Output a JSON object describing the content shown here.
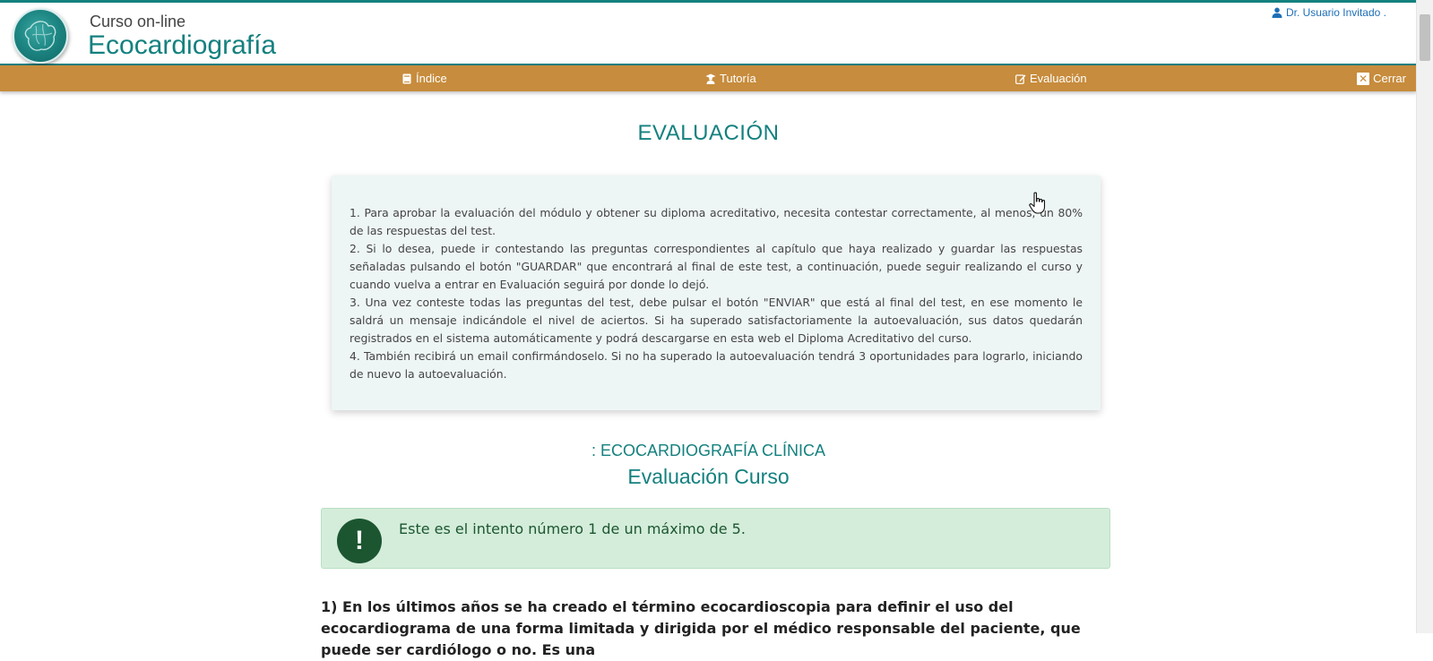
{
  "header": {
    "brand_small": "Curso  on-line",
    "brand_big": "Ecocardiografía",
    "user": "Dr. Usuario Invitado ."
  },
  "nav": {
    "indice": "Índice",
    "tutoria": "Tutoría",
    "evaluacion": "Evaluación",
    "cerrar": "Cerrar"
  },
  "main": {
    "title": "EVALUACIÓN",
    "instructions": [
      "1. Para aprobar la evaluación del módulo y obtener su diploma acreditativo, necesita contestar correctamente, al menos, un 80% de las respuestas del test.",
      "2. Si lo desea, puede ir contestando las preguntas correspondientes al capítulo que haya realizado y guardar las respuestas señaladas pulsando el botón \"GUARDAR\" que encontrará al final de este test, a continuación, puede seguir realizando el curso y cuando vuelva a entrar en Evaluación seguirá por donde lo dejó.",
      "3. Una vez conteste todas las preguntas del test, debe pulsar el botón \"ENVIAR\" que está al final del test, en ese momento le saldrá un mensaje indicándole el nivel de aciertos. Si ha superado satisfactoriamente la autoevaluación, sus datos quedarán registrados en el sistema automáticamente y podrá descargarse en esta web el Diploma Acreditativo del curso.",
      "4. También recibirá un email confirmándoselo. Si no ha superado la autoevaluación tendrá 3 oportunidades para lograrlo, iniciando de nuevo la autoevaluación."
    ],
    "module_title": ": ECOCARDIOGRAFÍA CLÍNICA",
    "eval_title": "Evaluación Curso",
    "alert_icon": "!",
    "alert_text": "Este es el intento número 1 de un máximo de 5.",
    "question_text": "1) En los últimos años se ha creado el término ecocardioscopia para definir el uso del ecocardiograma de una forma limitada y dirigida por el médico responsable del paciente, que puede ser cardiólogo o no. Es una"
  },
  "colors": {
    "teal": "#14817f",
    "nav_bg": "#c78c3d",
    "alert_bg": "#d4edda",
    "alert_dark": "#1c5631",
    "instructions_bg": "#eef5f5"
  },
  "icons": {
    "logo": "heart-logo",
    "user": "user-icon",
    "indice": "book-icon",
    "tutoria": "teacher-icon",
    "evaluacion": "edit-icon",
    "cerrar": "close-icon",
    "cursor": "hand-pointer-icon"
  }
}
